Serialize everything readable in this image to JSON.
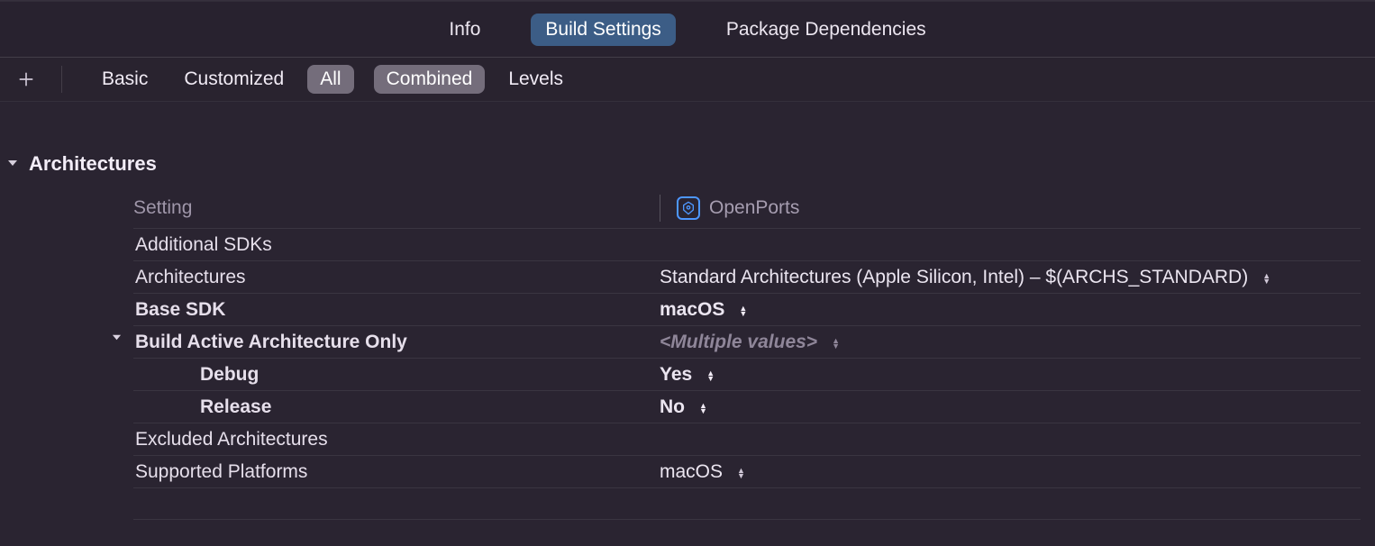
{
  "tabs": {
    "info": "Info",
    "build_settings": "Build Settings",
    "package_dependencies": "Package Dependencies"
  },
  "filters": {
    "basic": "Basic",
    "customized": "Customized",
    "all": "All",
    "combined": "Combined",
    "levels": "Levels"
  },
  "section": {
    "title": "Architectures",
    "columns": {
      "setting": "Setting",
      "target_name": "OpenPorts"
    },
    "rows": {
      "additional_sdks": {
        "label": "Additional SDKs",
        "value": ""
      },
      "architectures": {
        "label": "Architectures",
        "value": "Standard Architectures (Apple Silicon, Intel)  –  $(ARCHS_STANDARD)"
      },
      "base_sdk": {
        "label": "Base SDK",
        "value": "macOS"
      },
      "build_active_arch_only": {
        "label": "Build Active Architecture Only",
        "value": "<Multiple values>"
      },
      "debug": {
        "label": "Debug",
        "value": "Yes"
      },
      "release": {
        "label": "Release",
        "value": "No"
      },
      "excluded_architectures": {
        "label": "Excluded Architectures",
        "value": ""
      },
      "supported_platforms": {
        "label": "Supported Platforms",
        "value": "macOS"
      }
    }
  }
}
